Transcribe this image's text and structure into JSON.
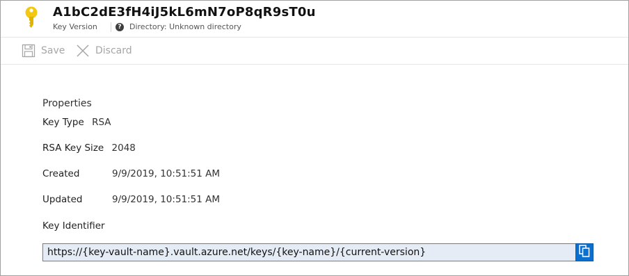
{
  "header": {
    "title": "A1bC2dE3fH4iJ5kL6mN7oP8qR9sT0u",
    "subtitle": "Key Version",
    "directory": "Directory: Unknown directory",
    "icons": {
      "key": "key-icon",
      "help": "help-icon"
    },
    "key_color": "#F2C811"
  },
  "toolbar": {
    "save_label": "Save",
    "discard_label": "Discard",
    "enabled": false
  },
  "properties": {
    "section_title": "Properties",
    "key_type_label": "Key Type",
    "key_type_value": "RSA",
    "key_size_label": "RSA Key Size",
    "key_size_value": "2048",
    "created_label": "Created",
    "created_value": "9/9/2019, 10:51:51 AM",
    "updated_label": "Updated",
    "updated_value": "9/9/2019, 10:51:51 AM",
    "identifier_label": "Key Identifier",
    "identifier_value": "https://{key-vault-name}.vault.azure.net/keys/{key-name}/{current-version}"
  },
  "colors": {
    "accent": "#0B6FD0",
    "disabled_text": "#A6A6A6",
    "input_bg": "#E6ECF6"
  }
}
